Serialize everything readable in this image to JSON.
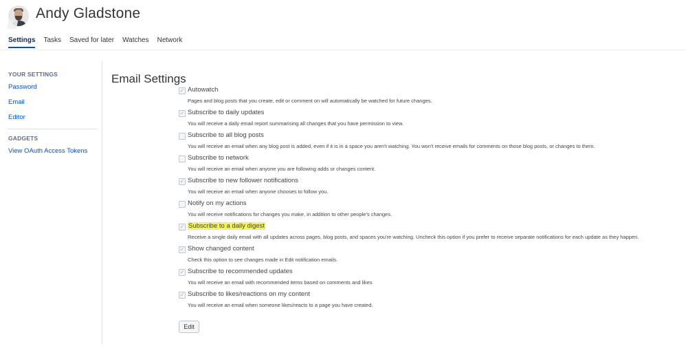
{
  "profile": {
    "name": "Andy Gladstone"
  },
  "tabs": [
    {
      "label": "Settings"
    },
    {
      "label": "Tasks"
    },
    {
      "label": "Saved for later"
    },
    {
      "label": "Watches"
    },
    {
      "label": "Network"
    }
  ],
  "sidebar": {
    "your_settings": "YOUR SETTINGS",
    "items": [
      {
        "label": "Password"
      },
      {
        "label": "Email"
      },
      {
        "label": "Editor"
      }
    ],
    "gadgets": "GADGETS",
    "gadget_items": [
      {
        "label": "View OAuth Access Tokens"
      }
    ]
  },
  "main": {
    "title": "Email Settings",
    "settings": [
      {
        "label": "Autowatch",
        "checked": true,
        "description": "Pages and blog posts that you create, edit or comment on will automatically be watched for future changes."
      },
      {
        "label": "Subscribe to daily updates",
        "checked": true,
        "description": "You will receive a daily email report summarising all changes that you have permission to view."
      },
      {
        "label": "Subscribe to all blog posts",
        "checked": false,
        "description": "You will receive an email when any blog post is added, even if it is in a space you aren't watching. You won't receive emails for comments on those blog posts, or changes to them."
      },
      {
        "label": "Subscribe to network",
        "checked": false,
        "description": "You will receive an email when anyone you are following adds or changes content."
      },
      {
        "label": "Subscribe to new follower notifications",
        "checked": true,
        "description": "You will receive an email when anyone chooses to follow you."
      },
      {
        "label": "Notify on my actions",
        "checked": false,
        "description": "You will receive notifications for changes you make, in addition to other people's changes."
      },
      {
        "label": "Subscribe to a daily digest",
        "checked": true,
        "description": "Receive a single daily email with all updates across pages, blog posts, and spaces you're watching. Uncheck this option if you prefer to receive separate notifications for each update as they happen."
      },
      {
        "label": "Show changed content",
        "checked": true,
        "description": "Check this option to see changes made in Edit notification emails."
      },
      {
        "label": "Subscribe to recommended updates",
        "checked": true,
        "description": "You will receive an email with recommended items based on comments and likes"
      },
      {
        "label": "Subscribe to likes/reactions on my content",
        "checked": true,
        "description": "You will receive an email when someone likes/reacts to a page you have created."
      }
    ],
    "edit_label": "Edit"
  }
}
